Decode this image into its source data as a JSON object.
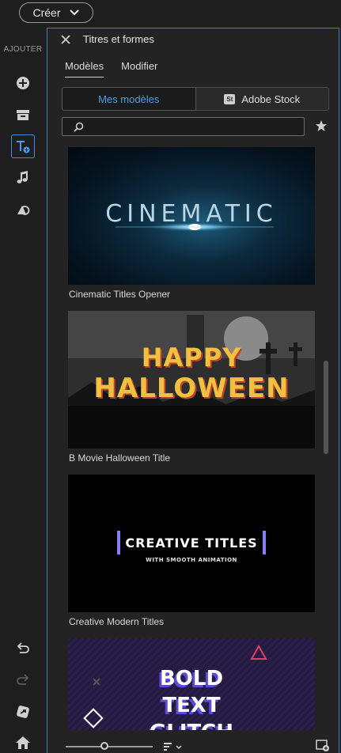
{
  "topbar": {
    "create_label": "Créer"
  },
  "rail": {
    "section_label": "AJOUTER",
    "items": [
      {
        "icon": "add-circle-icon"
      },
      {
        "icon": "archive-icon"
      },
      {
        "icon": "titles-icon",
        "active": true
      },
      {
        "icon": "music-icon"
      },
      {
        "icon": "shapes-icon"
      }
    ],
    "bottom_items": [
      {
        "icon": "undo-icon"
      },
      {
        "icon": "redo-icon"
      },
      {
        "icon": "share-icon"
      },
      {
        "icon": "home-icon"
      }
    ]
  },
  "panel": {
    "title": "Titres et formes",
    "tabs": [
      {
        "label": "Modèles",
        "active": true
      },
      {
        "label": "Modifier",
        "active": false
      }
    ],
    "segment": {
      "left_label": "Mes modèles",
      "right_badge": "St",
      "right_label": "Adobe Stock"
    },
    "search": {
      "placeholder": ""
    },
    "templates": [
      {
        "label": "Cinematic Titles Opener",
        "thumb_text": "CINEMATIC"
      },
      {
        "label": "B Movie Halloween Title",
        "thumb_text_1": "HAPPY",
        "thumb_text_2": "HALLOWEEN"
      },
      {
        "label": "Creative Modern Titles",
        "thumb_text_1": "CREATIVE TITLES",
        "thumb_text_2": "WITH SMOOTH ANIMATION"
      },
      {
        "thumb_text_1": "BOLD",
        "thumb_text_2": "TEXT",
        "thumb_text_3": "GLITCH"
      }
    ]
  },
  "colors": {
    "accent": "#3d8ce8",
    "background": "#232323",
    "rail": "#1e1e1e"
  }
}
